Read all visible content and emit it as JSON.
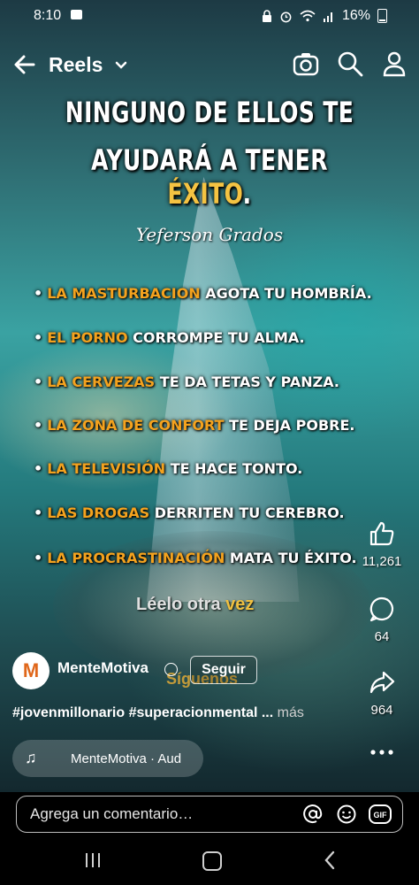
{
  "status_bar": {
    "time": "8:10",
    "battery": "16%"
  },
  "top_bar": {
    "title": "Reels"
  },
  "overlay": {
    "headline_line1": "NINGUNO DE ELLOS TE",
    "headline_line2_prefix": "AYUDARÁ A TENER",
    "headline_line2_highlight": "ÉXITO",
    "headline_line2_suffix": ".",
    "signature": "Yeferson Grados",
    "bullets": [
      {
        "highlight": "LA MASTURBACION",
        "rest": "AGOTA TU HOMBRÍA."
      },
      {
        "highlight": "EL PORNO",
        "rest": "CORROMPE TU ALMA."
      },
      {
        "highlight": "LA CERVEZAS",
        "rest": "TE DA TETAS Y PANZA."
      },
      {
        "highlight": "LA ZONA DE CONFORT",
        "rest": "TE DEJA POBRE."
      },
      {
        "highlight": "LA TELEVISIÓN",
        "rest": "TE HACE TONTO."
      },
      {
        "highlight": "LAS DROGAS",
        "rest": "DERRITEN TU CEREBRO."
      },
      {
        "highlight": "LA PROCRASTINACIÓN",
        "rest": "MATA TU ÉXITO."
      }
    ],
    "relee": "Léelo otra",
    "relee_highlight": "vez",
    "follow_overlay": "Síguenos"
  },
  "actions": {
    "likes": "11,261",
    "comments": "64",
    "shares": "964"
  },
  "post": {
    "avatar_letter": "M",
    "author": "MenteMotiva",
    "follow_label": "Seguir",
    "caption": "#jovenmillonario #superacionmental ...",
    "more_label": "más",
    "audio": "MenteMotiva · Aud"
  },
  "comment": {
    "placeholder": "Agrega un comentario…",
    "gif_label": "GIF"
  },
  "colors": {
    "highlight": "#f4a21e",
    "headline_highlight": "#f5c342"
  }
}
